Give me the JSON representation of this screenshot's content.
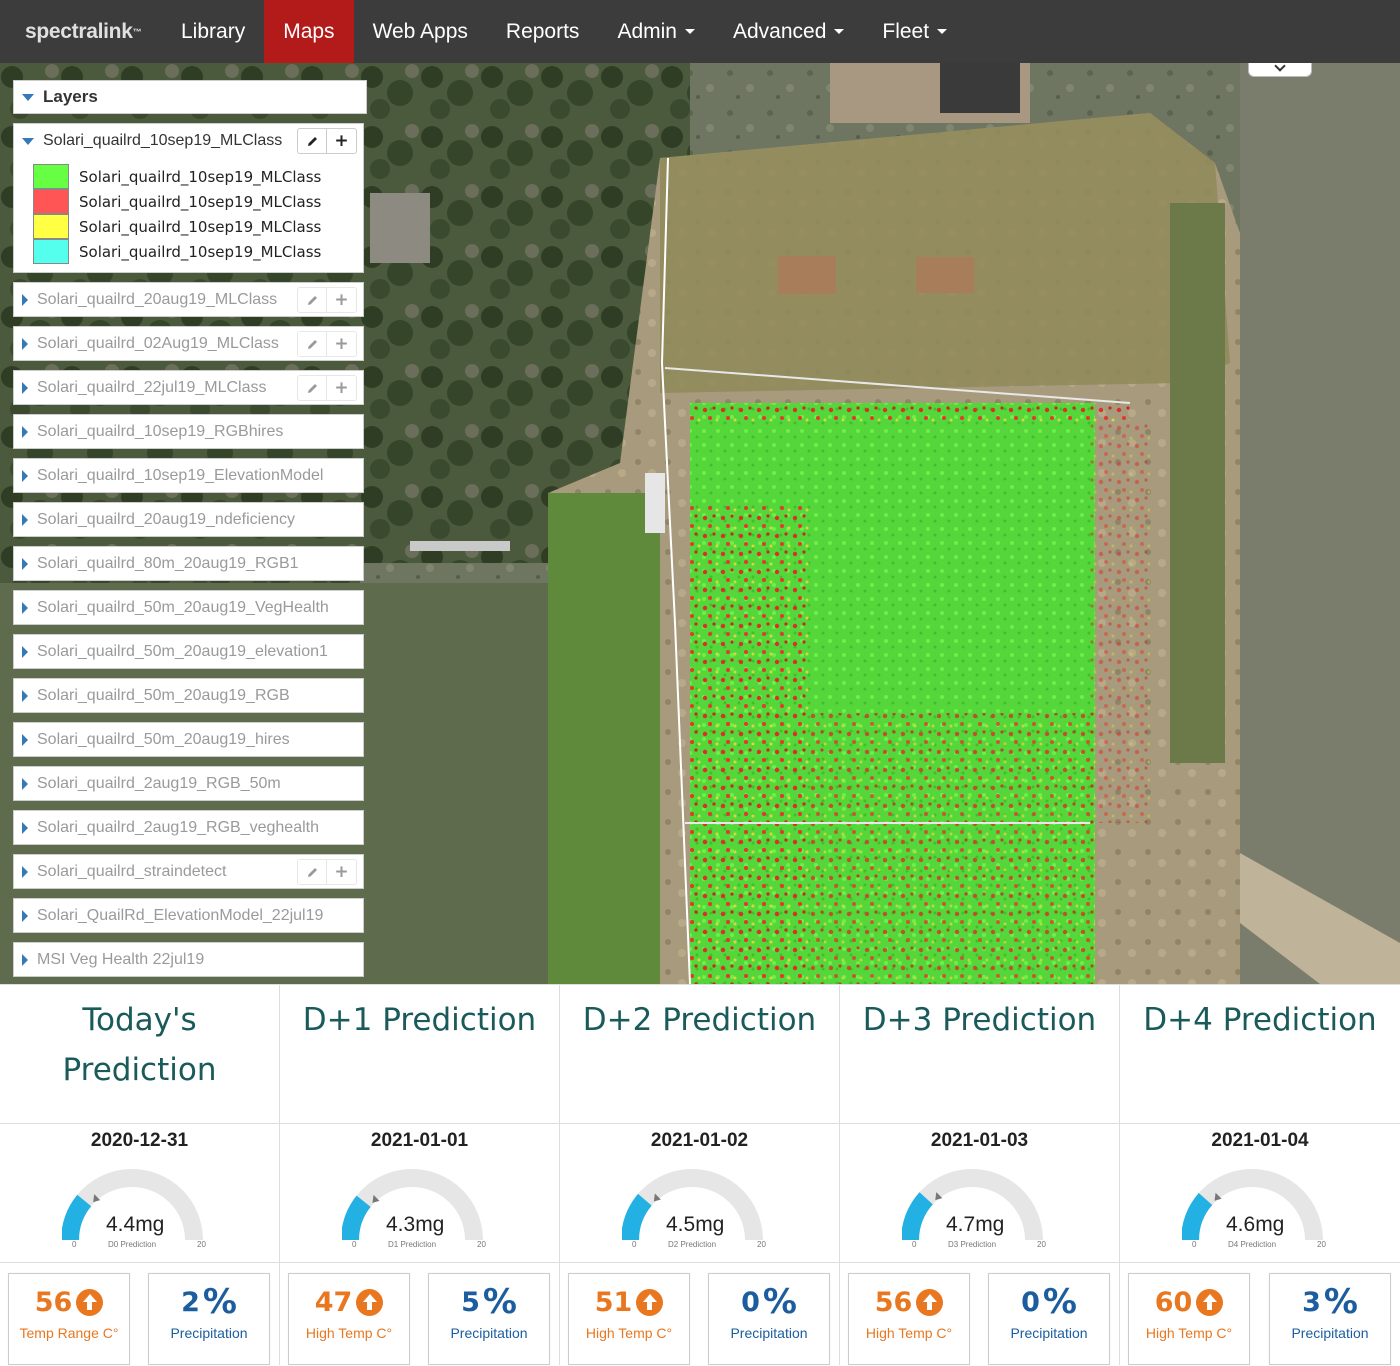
{
  "nav": {
    "brand": "spectralink",
    "items": [
      {
        "label": "Library",
        "active": false,
        "dropdown": false
      },
      {
        "label": "Maps",
        "active": true,
        "dropdown": false
      },
      {
        "label": "Web Apps",
        "active": false,
        "dropdown": false
      },
      {
        "label": "Reports",
        "active": false,
        "dropdown": false
      },
      {
        "label": "Admin",
        "active": false,
        "dropdown": true
      },
      {
        "label": "Advanced",
        "active": false,
        "dropdown": true
      },
      {
        "label": "Fleet",
        "active": false,
        "dropdown": true
      }
    ]
  },
  "layers": {
    "header": "Layers",
    "expanded": {
      "name": "Solari_quailrd_10sep19_MLClass",
      "legend": [
        {
          "label": "Solari_quailrd_10sep19_MLClass",
          "color": "#66ff44"
        },
        {
          "label": "Solari_quailrd_10sep19_MLClass",
          "color": "#ff5555"
        },
        {
          "label": "Solari_quailrd_10sep19_MLClass",
          "color": "#ffff44"
        },
        {
          "label": "Solari_quailrd_10sep19_MLClass",
          "color": "#55ffee"
        }
      ]
    },
    "items": [
      {
        "name": "Solari_quailrd_20aug19_MLClass",
        "buttons": true
      },
      {
        "name": "Solari_quailrd_02Aug19_MLClass",
        "buttons": true
      },
      {
        "name": "Solari_quailrd_22jul19_MLClass",
        "buttons": true
      },
      {
        "name": "Solari_quailrd_10sep19_RGBhires",
        "buttons": false
      },
      {
        "name": "Solari_quailrd_10sep19_ElevationModel",
        "buttons": false
      },
      {
        "name": "Solari_quailrd_20aug19_ndeficiency",
        "buttons": false
      },
      {
        "name": "Solari_quailrd_80m_20aug19_RGB1",
        "buttons": false
      },
      {
        "name": "Solari_quailrd_50m_20aug19_VegHealth",
        "buttons": false
      },
      {
        "name": "Solari_quailrd_50m_20aug19_elevation1",
        "buttons": false
      },
      {
        "name": "Solari_quailrd_50m_20aug19_RGB",
        "buttons": false
      },
      {
        "name": "Solari_quailrd_50m_20aug19_hires",
        "buttons": false
      },
      {
        "name": "Solari_quailrd_2aug19_RGB_50m",
        "buttons": false
      },
      {
        "name": "Solari_quailrd_2aug19_RGB_veghealth",
        "buttons": false
      },
      {
        "name": "Solari_quailrd_straindetect",
        "buttons": true
      },
      {
        "name": "Solari_QuailRd_ElevationModel_22jul19",
        "buttons": false
      },
      {
        "name": "MSI Veg Health 22jul19",
        "buttons": false
      }
    ]
  },
  "predictions": [
    {
      "title": "Today's Prediction",
      "date": "2020-12-31",
      "value": 4.4,
      "value_label": "4.4mg",
      "gauge_label": "D0 Prediction",
      "min": "0",
      "max": "20",
      "stat1": {
        "value": "56",
        "label": "Temp Range C°"
      },
      "stat2": {
        "value": "2",
        "label": "Precipitation"
      }
    },
    {
      "title": "D+1 Prediction",
      "date": "2021-01-01",
      "value": 4.3,
      "value_label": "4.3mg",
      "gauge_label": "D1 Prediction",
      "min": "0",
      "max": "20",
      "stat1": {
        "value": "47",
        "label": "High Temp C°"
      },
      "stat2": {
        "value": "5",
        "label": "Precipitation"
      }
    },
    {
      "title": "D+2 Prediction",
      "date": "2021-01-02",
      "value": 4.5,
      "value_label": "4.5mg",
      "gauge_label": "D2 Prediction",
      "min": "0",
      "max": "20",
      "stat1": {
        "value": "51",
        "label": "High Temp C°"
      },
      "stat2": {
        "value": "0",
        "label": "Precipitation"
      }
    },
    {
      "title": "D+3 Prediction",
      "date": "2021-01-03",
      "value": 4.7,
      "value_label": "4.7mg",
      "gauge_label": "D3 Prediction",
      "min": "0",
      "max": "20",
      "stat1": {
        "value": "56",
        "label": "High Temp C°"
      },
      "stat2": {
        "value": "0",
        "label": "Precipitation"
      }
    },
    {
      "title": "D+4 Prediction",
      "date": "2021-01-04",
      "value": 4.6,
      "value_label": "4.6mg",
      "gauge_label": "D4 Prediction",
      "min": "0",
      "max": "20",
      "stat1": {
        "value": "60",
        "label": "High Temp C°"
      },
      "stat2": {
        "value": "3",
        "label": "Precipitation"
      }
    }
  ],
  "colors": {
    "nav_bg": "#3c3c3c",
    "nav_active": "#b31b1b",
    "gauge_fill": "#23b0e3",
    "gauge_track": "#e6e6e6",
    "temp": "#e8771f",
    "precip": "#1b5d9e",
    "title": "#1a5a5a"
  },
  "icons": {
    "edit": "pencil-icon",
    "add": "plus-icon",
    "temp": "arrow-up-circle-icon",
    "precip": "percent-icon"
  }
}
